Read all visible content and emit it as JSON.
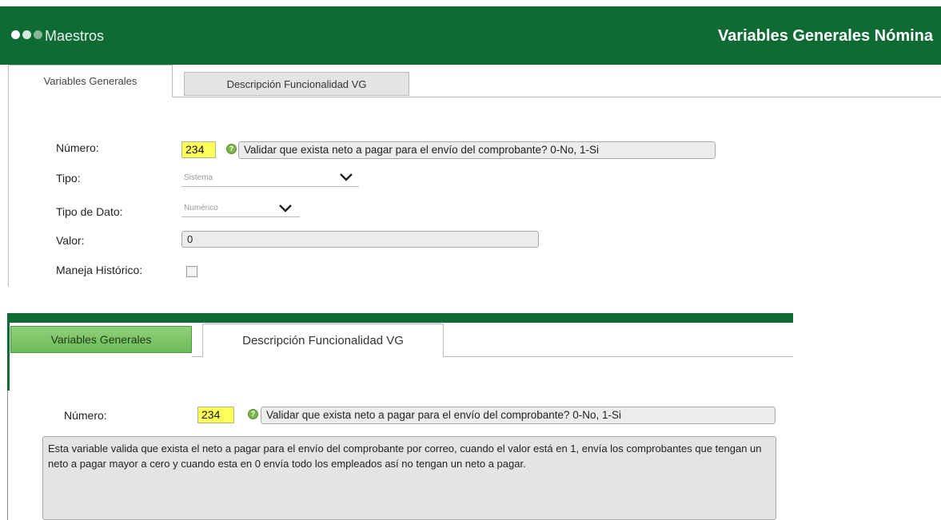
{
  "header": {
    "brand": "Maestros",
    "title": "Variables Generales Nómina",
    "colors": {
      "bar": "#0f6b34",
      "accent_tab": "#6dbb57",
      "highlight": "#ffff5c"
    }
  },
  "top_panel": {
    "tabs": [
      {
        "label": "Variables Generales",
        "active": true
      },
      {
        "label": "Descripción Funcionalidad VG",
        "active": false
      }
    ],
    "form": {
      "numero_label": "Número:",
      "numero_value": "234",
      "numero_description": "Validar que exista neto a pagar para el envío del comprobante? 0-No, 1-Si",
      "tipo_label": "Tipo:",
      "tipo_value": "Sistema",
      "tipo_dato_label": "Tipo de Dato:",
      "tipo_dato_value": "Numérico",
      "valor_label": "Valor:",
      "valor_value": "0",
      "historico_label": "Maneja Histórico:",
      "historico_checked": false
    }
  },
  "bottom_panel": {
    "tabs": [
      {
        "label": "Variables Generales",
        "active": false
      },
      {
        "label": "Descripción Funcionalidad VG",
        "active": true
      }
    ],
    "numero_label": "Número:",
    "numero_value": "234",
    "numero_description": "Validar que exista neto a pagar para el envío del comprobante? 0-No, 1-Si",
    "long_description": "Esta variable valida que exista el neto a pagar para el envío del comprobante por correo, cuando el valor está en 1, envía los comprobantes que tengan un neto a pagar mayor a cero y cuando esta en 0 envía todo los empleados así no tengan un neto a pagar."
  },
  "icons": [
    "window-dots-icon",
    "help-icon",
    "chevron-down-icon"
  ]
}
